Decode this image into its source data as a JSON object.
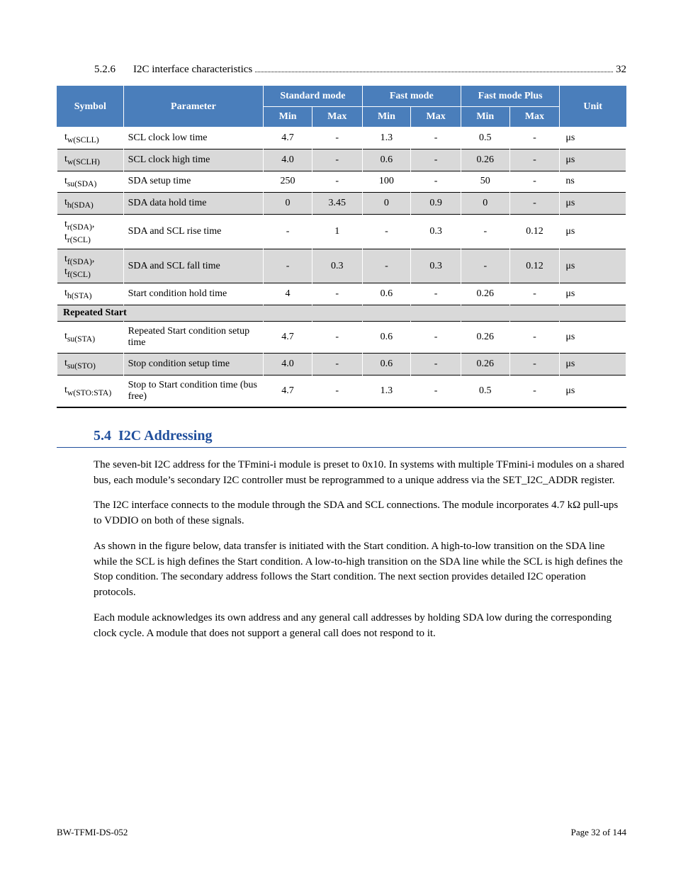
{
  "toc": {
    "num": "5.2.6",
    "title": "I2C interface characteristics",
    "page": "32"
  },
  "table": {
    "head": {
      "symbol": "Symbol",
      "parameter": "Parameter",
      "standard": "Standard mode",
      "fast": "Fast mode",
      "fastplus": "Fast mode Plus",
      "unit": "Unit",
      "min": "Min",
      "max": "Max"
    },
    "rows": [
      {
        "shaded": false,
        "sym": "t_{w(SCLL)}",
        "param": "SCL clock low time",
        "vals": [
          "4.7",
          "-",
          "1.3",
          "-",
          "0.5",
          "-"
        ],
        "unit": "μs"
      },
      {
        "shaded": true,
        "sym": "t_{w(SCLH)}",
        "param": "SCL clock high time",
        "vals": [
          "4.0",
          "-",
          "0.6",
          "-",
          "0.26",
          "-"
        ],
        "unit": "μs"
      },
      {
        "shaded": false,
        "sym": "t_{su(SDA)}",
        "param": "SDA setup time",
        "vals": [
          "250",
          "-",
          "100",
          "-",
          "50",
          "-"
        ],
        "unit": "ns"
      },
      {
        "shaded": true,
        "sym": "t_{h(SDA)}",
        "param": "SDA data hold time",
        "vals": [
          "0",
          "3.45",
          "0",
          "0.9",
          "0",
          "-"
        ],
        "unit": "μs"
      },
      {
        "shaded": false,
        "sym": "t_{r(SDA)}, t_{r(SCL)}",
        "param": "SDA and SCL rise time",
        "vals": [
          "-",
          "1",
          "-",
          "0.3",
          "-",
          "0.12"
        ],
        "unit": "μs"
      },
      {
        "shaded": true,
        "sym": "t_{f(SDA)}, t_{f(SCL)}",
        "param": "SDA and SCL fall time",
        "vals": [
          "-",
          "0.3",
          "-",
          "0.3",
          "-",
          "0.12"
        ],
        "unit": "μs"
      },
      {
        "shaded": false,
        "sym": "t_{h(STA)}",
        "param": "Start condition hold time",
        "vals": [
          "4",
          "-",
          "0.6",
          "-",
          "0.26",
          "-"
        ],
        "unit": "μs"
      }
    ],
    "sect": "Repeated Start",
    "rows2": [
      {
        "shaded": false,
        "sym": "t_{su(STA)}",
        "param": "Repeated Start condition setup time",
        "vals": [
          "4.7",
          "-",
          "0.6",
          "-",
          "0.26",
          "-"
        ],
        "unit": "μs"
      },
      {
        "shaded": true,
        "sym": "t_{su(STO)}",
        "param": "Stop condition setup time",
        "vals": [
          "4.0",
          "-",
          "0.6",
          "-",
          "0.26",
          "-"
        ],
        "unit": "μs"
      },
      {
        "shaded": false,
        "sym": "t_{w(STO:STA)}",
        "param": "Stop to Start condition time (bus free)",
        "vals": [
          "4.7",
          "-",
          "1.3",
          "-",
          "0.5",
          "-"
        ],
        "unit": "μs"
      }
    ]
  },
  "section": {
    "num": "5.4",
    "title": "I2C Addressing"
  },
  "body": {
    "p1": "The seven-bit I2C address for the TFmini-i module is preset to 0x10. In systems with multiple TFmini-i modules on a shared bus, each module’s secondary I2C controller must be reprogrammed to a unique address via the SET_I2C_ADDR register.",
    "p2a": "The I2C interface connects to the module through the SDA and SCL connections. The module incorporates 4.7 kΩ pull-ups to VDDIO on both of these signals.",
    "p3": "As shown in the figure below, data transfer is initiated with the Start condition. A high-to-low transition on the SDA line while the SCL is high defines the Start condition. A low-to-high transition on the SDA line while the SCL is high defines the Stop condition. The secondary address follows the Start condition. The next section provides detailed I2C operation protocols.",
    "p4": "Each module acknowledges its own address and any general call addresses by holding SDA low during the corresponding clock cycle. A module that does not support a general call does not respond to it."
  },
  "footer": {
    "left": "BW-TFMI-DS-052",
    "right": "Page 32 of 144"
  }
}
